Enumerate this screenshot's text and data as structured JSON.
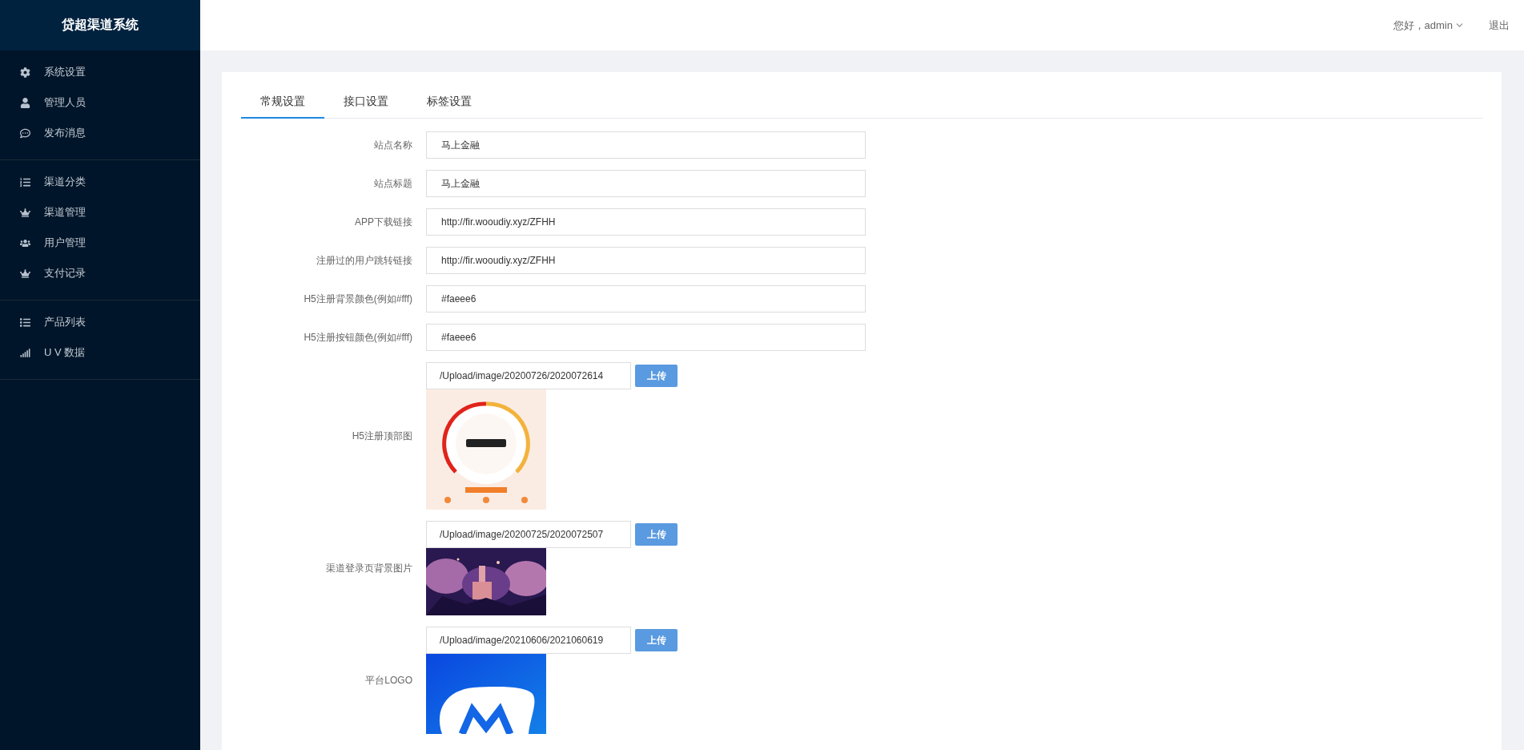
{
  "sidebar": {
    "title": "贷超渠道系统",
    "groups": [
      {
        "items": [
          {
            "label": "系统设置"
          },
          {
            "label": "管理人员"
          },
          {
            "label": "发布消息"
          }
        ]
      },
      {
        "items": [
          {
            "label": "渠道分类"
          },
          {
            "label": "渠道管理"
          },
          {
            "label": "用户管理"
          },
          {
            "label": "支付记录"
          }
        ]
      },
      {
        "items": [
          {
            "label": "产品列表"
          },
          {
            "label": "U V 数据"
          }
        ]
      }
    ]
  },
  "header": {
    "greeting": "您好，admin",
    "logout": "退出"
  },
  "tabs": [
    {
      "label": "常规设置",
      "selected": true
    },
    {
      "label": "接口设置",
      "selected": false
    },
    {
      "label": "标签设置",
      "selected": false
    }
  ],
  "form": [
    {
      "kind": "text",
      "label": "站点名称",
      "value": "马上金融"
    },
    {
      "kind": "text",
      "label": "站点标题",
      "value": "马上金融"
    },
    {
      "kind": "text",
      "label": "APP下载链接",
      "value": "http://fir.wooudiy.xyz/ZFHH"
    },
    {
      "kind": "text",
      "label": "注册过的用户跳转链接",
      "value": "http://fir.wooudiy.xyz/ZFHH"
    },
    {
      "kind": "text",
      "label": "H5注册背景颜色(例如#fff)",
      "value": "#faeee6"
    },
    {
      "kind": "text",
      "label": "H5注册按钮颜色(例如#fff)",
      "value": "#faeee6"
    },
    {
      "kind": "upload",
      "label": "H5注册顶部图",
      "value": "/Upload/image/20200726/2020072614",
      "button": "上传"
    },
    {
      "kind": "upload",
      "label": "渠道登录页背景图片",
      "value": "/Upload/image/20200725/2020072507",
      "button": "上传"
    },
    {
      "kind": "upload",
      "label": "平台LOGO",
      "value": "/Upload/image/20210606/2021060619",
      "button": "上传"
    }
  ]
}
